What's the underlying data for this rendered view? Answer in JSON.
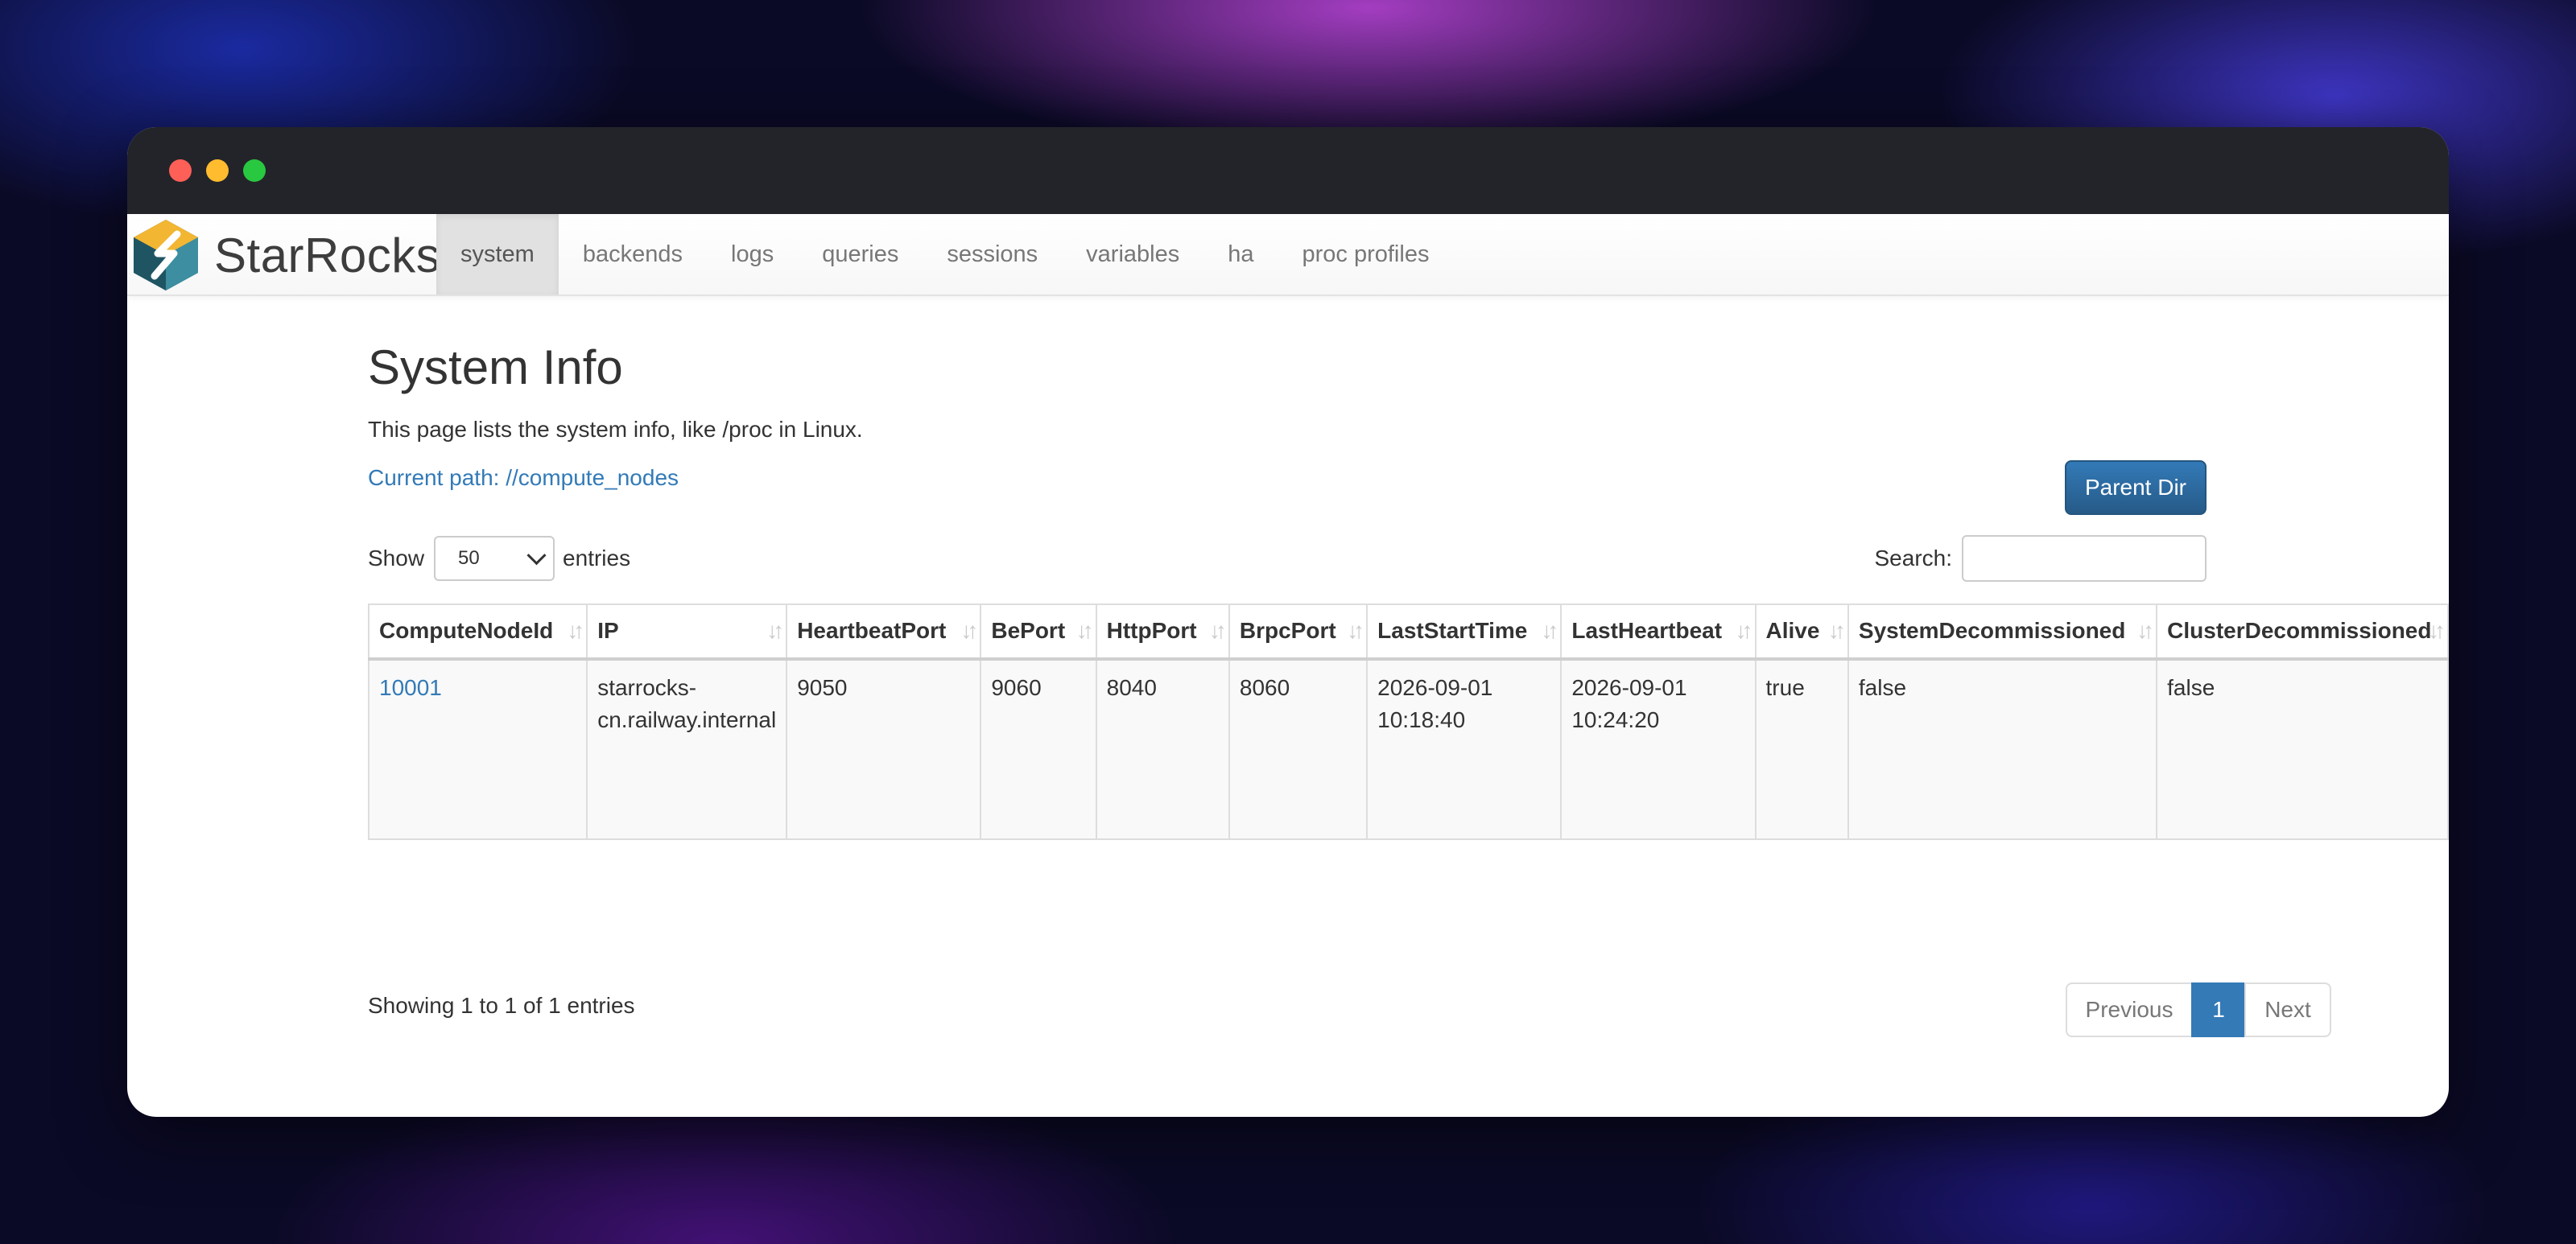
{
  "brand": {
    "name": "StarRocks"
  },
  "nav": {
    "items": [
      {
        "label": "system",
        "active": true
      },
      {
        "label": "backends"
      },
      {
        "label": "logs"
      },
      {
        "label": "queries"
      },
      {
        "label": "sessions"
      },
      {
        "label": "variables"
      },
      {
        "label": "ha"
      },
      {
        "label": "proc profiles"
      }
    ]
  },
  "page": {
    "title": "System Info",
    "description": "This page lists the system info, like /proc in Linux.",
    "current_path": "Current path: //compute_nodes",
    "parent_dir_label": "Parent Dir"
  },
  "controls": {
    "show_label": "Show",
    "entries_value": "50",
    "entries_label": "entries",
    "search_label": "Search:"
  },
  "table": {
    "columns": [
      "ComputeNodeId",
      "IP",
      "HeartbeatPort",
      "BePort",
      "HttpPort",
      "BrpcPort",
      "LastStartTime",
      "LastHeartbeat",
      "Alive",
      "SystemDecommissioned",
      "ClusterDecommissioned"
    ],
    "rows": [
      [
        "10001",
        "starrocks-cn.railway.internal",
        "9050",
        "9060",
        "8040",
        "8060",
        "2026-09-01 10:18:40",
        "2026-09-01 10:24:20",
        "true",
        "false",
        "false"
      ]
    ]
  },
  "footer": {
    "info": "Showing 1 to 1 of 1 entries",
    "previous": "Previous",
    "current_page": "1",
    "next": "Next"
  },
  "colors": {
    "accent": "#337ab7",
    "titlebar": "#232429"
  }
}
